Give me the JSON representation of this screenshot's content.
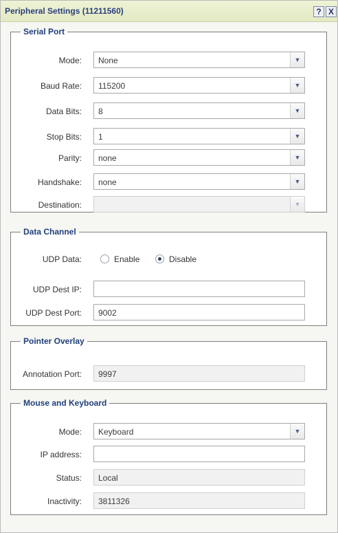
{
  "window": {
    "title": "Peripheral Settings (11211560)",
    "help_glyph": "?",
    "close_glyph": "X"
  },
  "serial_port": {
    "legend": "Serial Port",
    "mode": {
      "label": "Mode:",
      "value": "None"
    },
    "baud_rate": {
      "label": "Baud Rate:",
      "value": "115200"
    },
    "data_bits": {
      "label": "Data Bits:",
      "value": "8"
    },
    "stop_bits": {
      "label": "Stop Bits:",
      "value": "1"
    },
    "parity": {
      "label": "Parity:",
      "value": "none"
    },
    "handshake": {
      "label": "Handshake:",
      "value": "none"
    },
    "destination": {
      "label": "Destination:",
      "value": ""
    }
  },
  "data_channel": {
    "legend": "Data Channel",
    "udp_data": {
      "label": "UDP Data:",
      "enable_label": "Enable",
      "disable_label": "Disable",
      "selected": "Disable"
    },
    "udp_dest_ip": {
      "label": "UDP Dest IP:",
      "value": ""
    },
    "udp_dest_port": {
      "label": "UDP Dest Port:",
      "value": "9002"
    }
  },
  "pointer_overlay": {
    "legend": "Pointer Overlay",
    "annotation_port": {
      "label": "Annotation Port:",
      "value": "9997"
    }
  },
  "mouse_keyboard": {
    "legend": "Mouse and Keyboard",
    "mode": {
      "label": "Mode:",
      "value": "Keyboard"
    },
    "ip_address": {
      "label": "IP address:",
      "value": ""
    },
    "status": {
      "label": "Status:",
      "value": "Local"
    },
    "inactivity": {
      "label": "Inactivity:",
      "value": "3811326"
    }
  },
  "icons": {
    "dropdown": "chevron-down-icon",
    "help": "help-icon",
    "close": "close-icon"
  },
  "colors": {
    "title_text": "#2a3f7c",
    "legend_text": "#1f3f7b",
    "titlebar_bg": "#e3e9c2"
  }
}
